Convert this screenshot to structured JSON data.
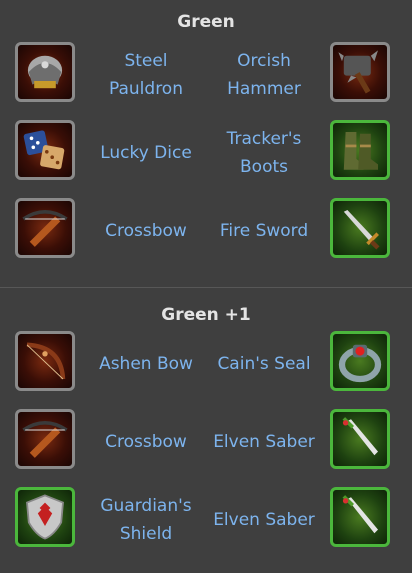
{
  "sections": [
    {
      "title": "Green",
      "rows": [
        {
          "left": {
            "name": "Steel Pauldron",
            "icon": "pauldron-icon",
            "frame": "grey"
          },
          "right": {
            "name": "Orcish Hammer",
            "icon": "hammer-icon",
            "frame": "grey"
          }
        },
        {
          "left": {
            "name": "Lucky Dice",
            "icon": "dice-icon",
            "frame": "grey"
          },
          "right": {
            "name": "Tracker's Boots",
            "icon": "boots-icon",
            "frame": "green"
          }
        },
        {
          "left": {
            "name": "Crossbow",
            "icon": "crossbow-icon",
            "frame": "grey"
          },
          "right": {
            "name": "Fire Sword",
            "icon": "sword-icon",
            "frame": "green"
          }
        }
      ]
    },
    {
      "title": "Green +1",
      "rows": [
        {
          "left": {
            "name": "Ashen Bow",
            "icon": "bow-icon",
            "frame": "grey"
          },
          "right": {
            "name": "Cain's Seal",
            "icon": "ring-icon",
            "frame": "green"
          }
        },
        {
          "left": {
            "name": "Crossbow",
            "icon": "crossbow-icon",
            "frame": "grey"
          },
          "right": {
            "name": "Elven Saber",
            "icon": "saber-icon",
            "frame": "green"
          }
        },
        {
          "left": {
            "name": "Guardian's Shield",
            "icon": "shield-icon",
            "frame": "green"
          },
          "right": {
            "name": "Elven Saber",
            "icon": "saber-icon",
            "frame": "green"
          }
        }
      ]
    }
  ],
  "colors": {
    "background": "#3f3f3f",
    "item_text": "#7db4ee",
    "title_text": "#e4e4e4",
    "grey_frame": "#8a8a8a",
    "green_frame": "#4bb73c"
  }
}
